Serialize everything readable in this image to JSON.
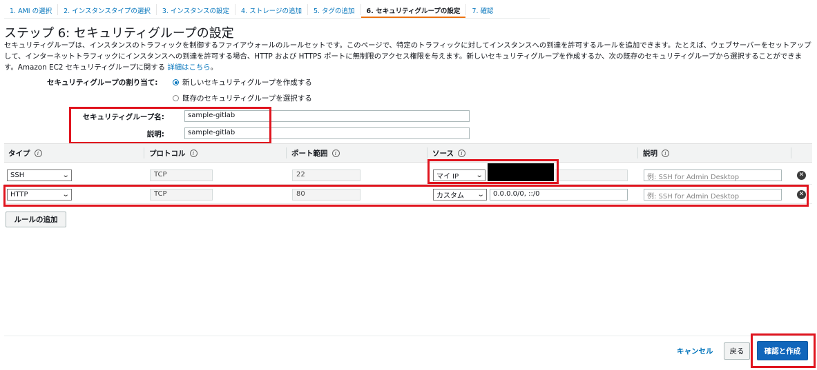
{
  "steps": [
    {
      "label": "1. AMI の選択"
    },
    {
      "label": "2. インスタンスタイプの選択"
    },
    {
      "label": "3. インスタンスの設定"
    },
    {
      "label": "4. ストレージの追加"
    },
    {
      "label": "5. タグの追加"
    },
    {
      "label": "6. セキュリティグループの設定"
    },
    {
      "label": "7. 確認"
    }
  ],
  "page": {
    "title": "ステップ 6: セキュリティグループの設定",
    "description": "セキュリティグループは、インスタンスのトラフィックを制御するファイアウォールのルールセットです。このページで、特定のトラフィックに対してインスタンスへの到達を許可するルールを追加できます。たとえば、ウェブサーバーをセットアップして、インターネットトラフィックにインスタンスへの到達を許可する場合、HTTP および HTTPS ポートに無制限のアクセス権限を与えます。新しいセキュリティグループを作成するか、次の既存のセキュリティグループから選択することができます。Amazon EC2 セキュリティグループに関する",
    "learn_more": "詳細はこちら",
    "period": "。"
  },
  "assign": {
    "label": "セキュリティグループの割り当て:",
    "option_new": "新しいセキュリティグループを作成する",
    "option_existing": "既存のセキュリティグループを選択する"
  },
  "group_name": {
    "label": "セキュリティグループ名:",
    "value": "sample-gitlab"
  },
  "group_desc": {
    "label": "説明:",
    "value": "sample-gitlab"
  },
  "table": {
    "headers": {
      "type": "タイプ",
      "protocol": "プロトコル",
      "port": "ポート範囲",
      "source": "ソース",
      "description": "説明"
    },
    "rows": [
      {
        "type": "SSH",
        "protocol": "TCP",
        "port": "22",
        "source_type": "マイ IP",
        "source_value": "",
        "desc_placeholder": "例: SSH for Admin Desktop"
      },
      {
        "type": "HTTP",
        "protocol": "TCP",
        "port": "80",
        "source_type": "カスタム",
        "source_value": "0.0.0.0/0, ::/0",
        "desc_placeholder": "例: SSH for Admin Desktop"
      }
    ]
  },
  "add_rule": "ルールの追加",
  "footer": {
    "cancel": "キャンセル",
    "back": "戻る",
    "review": "確認と作成"
  },
  "colors": {
    "link": "#0073bb",
    "primary": "#1166bb",
    "highlight": "#e0141e"
  }
}
